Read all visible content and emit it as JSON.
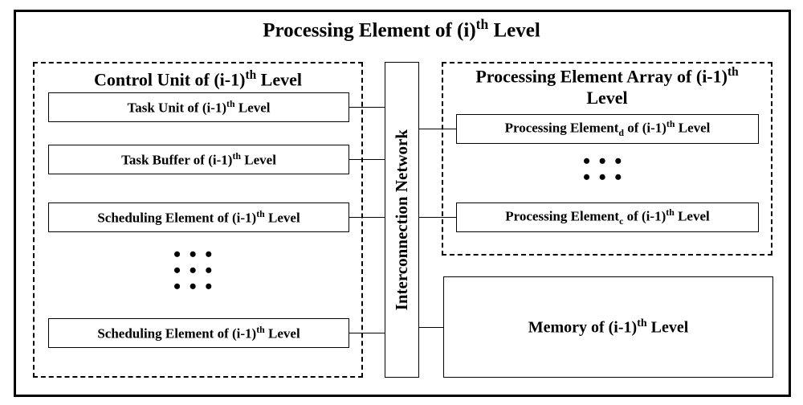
{
  "title": {
    "prefix": "Processing Element of (i)",
    "sup": "th",
    "suffix": " Level"
  },
  "control_unit": {
    "title": {
      "prefix": "Control Unit of  (i-1)",
      "sup": "th",
      "suffix": " Level"
    },
    "task_unit": {
      "prefix": "Task Unit of (i-1)",
      "sup": "th",
      "suffix": " Level"
    },
    "task_buffer": {
      "prefix": "Task Buffer of (i-1)",
      "sup": "th",
      "suffix": " Level"
    },
    "sched1": {
      "prefix": "Scheduling Element of (i-1)",
      "sup": "th",
      "suffix": " Level"
    },
    "sched2": {
      "prefix": "Scheduling Element of (i-1)",
      "sup": "th",
      "suffix": " Level"
    }
  },
  "interconnect": "Interconnection Network",
  "pe_array": {
    "title": {
      "prefix": "Processing Element Array of (i-1)",
      "sup": "th",
      "suffix": " Level"
    },
    "pe_d": {
      "prefix": "Processing Element",
      "sub": "d",
      "mid": " of (i-1)",
      "sup": "th",
      "suffix": " Level"
    },
    "pe_c": {
      "prefix": "Processing Element",
      "sub": "c",
      "mid": " of (i-1)",
      "sup": "th",
      "suffix": " Level"
    }
  },
  "memory": {
    "prefix": "Memory of (i-1)",
    "sup": "th",
    "suffix": " Level"
  }
}
